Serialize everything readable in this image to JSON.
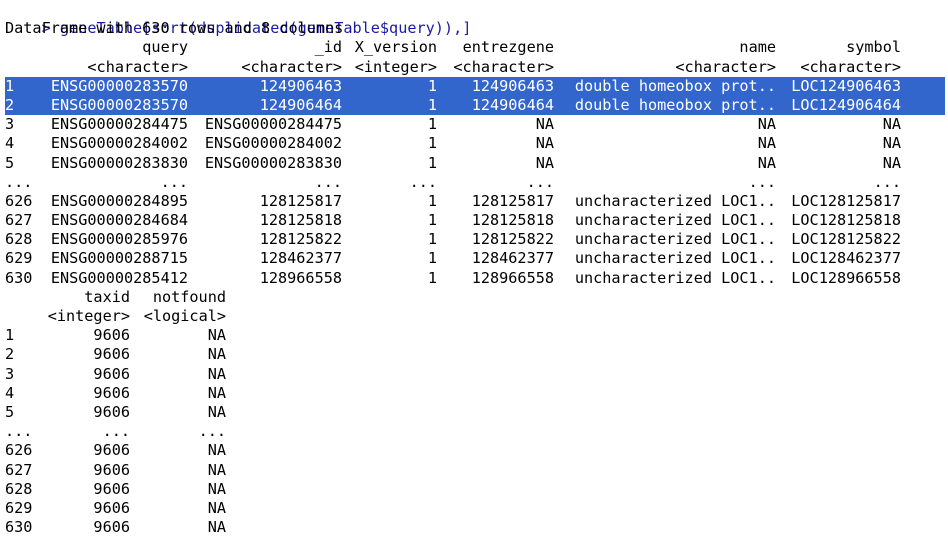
{
  "command": {
    "prompt": ">",
    "text": "geneTable[sort(duplicated(geneTable$query)),]"
  },
  "summary": "DataFrame with 630 rows and 8 columns",
  "block1": {
    "headers": [
      "query",
      "_id",
      "X_version",
      "entrezgene",
      "name",
      "symbol"
    ],
    "types": [
      "<character>",
      "<character>",
      "<integer>",
      "<character>",
      "<character>",
      "<character>"
    ],
    "rows": [
      {
        "rowname": "1",
        "cells": [
          "ENSG00000283570",
          "124906463",
          "1",
          "124906463",
          "double homeobox prot..",
          "LOC124906463"
        ],
        "selected": true
      },
      {
        "rowname": "2",
        "cells": [
          "ENSG00000283570",
          "124906464",
          "1",
          "124906464",
          "double homeobox prot..",
          "LOC124906464"
        ],
        "selected": true
      },
      {
        "rowname": "3",
        "cells": [
          "ENSG00000284475",
          "ENSG00000284475",
          "1",
          "NA",
          "NA",
          "NA"
        ],
        "selected": false
      },
      {
        "rowname": "4",
        "cells": [
          "ENSG00000284002",
          "ENSG00000284002",
          "1",
          "NA",
          "NA",
          "NA"
        ],
        "selected": false
      },
      {
        "rowname": "5",
        "cells": [
          "ENSG00000283830",
          "ENSG00000283830",
          "1",
          "NA",
          "NA",
          "NA"
        ],
        "selected": false
      },
      {
        "rowname": "...",
        "cells": [
          "...",
          "...",
          "...",
          "...",
          "...",
          "..."
        ],
        "selected": false
      },
      {
        "rowname": "626",
        "cells": [
          "ENSG00000284895",
          "128125817",
          "1",
          "128125817",
          "uncharacterized LOC1..",
          "LOC128125817"
        ],
        "selected": false
      },
      {
        "rowname": "627",
        "cells": [
          "ENSG00000284684",
          "128125818",
          "1",
          "128125818",
          "uncharacterized LOC1..",
          "LOC128125818"
        ],
        "selected": false
      },
      {
        "rowname": "628",
        "cells": [
          "ENSG00000285976",
          "128125822",
          "1",
          "128125822",
          "uncharacterized LOC1..",
          "LOC128125822"
        ],
        "selected": false
      },
      {
        "rowname": "629",
        "cells": [
          "ENSG00000288715",
          "128462377",
          "1",
          "128462377",
          "uncharacterized LOC1..",
          "LOC128462377"
        ],
        "selected": false
      },
      {
        "rowname": "630",
        "cells": [
          "ENSG00000285412",
          "128966558",
          "1",
          "128966558",
          "uncharacterized LOC1..",
          "LOC128966558"
        ],
        "selected": false
      }
    ]
  },
  "block2": {
    "headers": [
      "taxid",
      "notfound"
    ],
    "types": [
      "<integer>",
      "<logical>"
    ],
    "rows": [
      {
        "rowname": "1",
        "cells": [
          "9606",
          "NA"
        ]
      },
      {
        "rowname": "2",
        "cells": [
          "9606",
          "NA"
        ]
      },
      {
        "rowname": "3",
        "cells": [
          "9606",
          "NA"
        ]
      },
      {
        "rowname": "4",
        "cells": [
          "9606",
          "NA"
        ]
      },
      {
        "rowname": "5",
        "cells": [
          "9606",
          "NA"
        ]
      },
      {
        "rowname": "...",
        "cells": [
          "...",
          "..."
        ]
      },
      {
        "rowname": "626",
        "cells": [
          "9606",
          "NA"
        ]
      },
      {
        "rowname": "627",
        "cells": [
          "9606",
          "NA"
        ]
      },
      {
        "rowname": "628",
        "cells": [
          "9606",
          "NA"
        ]
      },
      {
        "rowname": "629",
        "cells": [
          "9606",
          "NA"
        ]
      },
      {
        "rowname": "630",
        "cells": [
          "9606",
          "NA"
        ]
      }
    ]
  },
  "colors": {
    "prompt": "#1a1aa6",
    "selection_background": "#3366cc",
    "selection_text": "#ffffff"
  }
}
